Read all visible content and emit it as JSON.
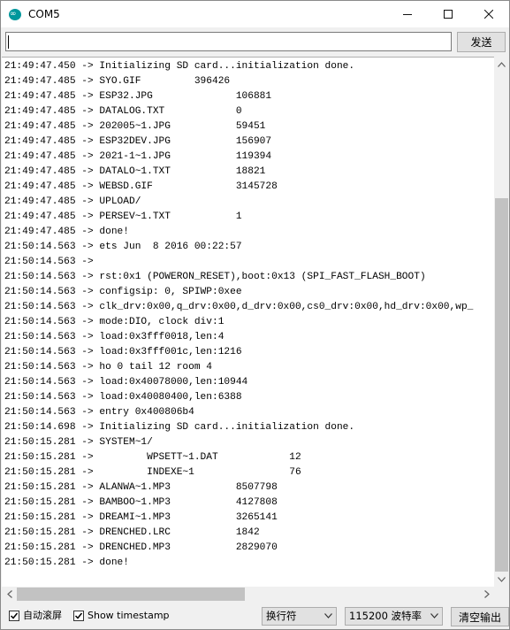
{
  "window": {
    "title": "COM5"
  },
  "input": {
    "value": "",
    "send_label": "发送"
  },
  "output_lines": [
    "21:49:47.450 -> Initializing SD card...initialization done.",
    "21:49:47.485 -> SYO.GIF         396426",
    "21:49:47.485 -> ESP32.JPG              106881",
    "21:49:47.485 -> DATALOG.TXT            0",
    "21:49:47.485 -> 202005~1.JPG           59451",
    "21:49:47.485 -> ESP32DEV.JPG           156907",
    "21:49:47.485 -> 2021-1~1.JPG           119394",
    "21:49:47.485 -> DATALO~1.TXT           18821",
    "21:49:47.485 -> WEBSD.GIF              3145728",
    "21:49:47.485 -> UPLOAD/",
    "21:49:47.485 -> PERSEV~1.TXT           1",
    "21:49:47.485 -> done!",
    "21:50:14.563 -> ets Jun  8 2016 00:22:57",
    "21:50:14.563 -> ",
    "21:50:14.563 -> rst:0x1 (POWERON_RESET),boot:0x13 (SPI_FAST_FLASH_BOOT)",
    "21:50:14.563 -> configsip: 0, SPIWP:0xee",
    "21:50:14.563 -> clk_drv:0x00,q_drv:0x00,d_drv:0x00,cs0_drv:0x00,hd_drv:0x00,wp_",
    "21:50:14.563 -> mode:DIO, clock div:1",
    "21:50:14.563 -> load:0x3fff0018,len:4",
    "21:50:14.563 -> load:0x3fff001c,len:1216",
    "21:50:14.563 -> ho 0 tail 12 room 4",
    "21:50:14.563 -> load:0x40078000,len:10944",
    "21:50:14.563 -> load:0x40080400,len:6388",
    "21:50:14.563 -> entry 0x400806b4",
    "21:50:14.698 -> Initializing SD card...initialization done.",
    "21:50:15.281 -> SYSTEM~1/",
    "21:50:15.281 ->         WPSETT~1.DAT            12",
    "21:50:15.281 ->         INDEXE~1                76",
    "21:50:15.281 -> ALANWA~1.MP3           8507798",
    "21:50:15.281 -> BAMBOO~1.MP3           4127808",
    "21:50:15.281 -> DREAMI~1.MP3           3265141",
    "21:50:15.281 -> DRENCHED.LRC           1842",
    "21:50:15.281 -> DRENCHED.MP3           2829070",
    "21:50:15.281 -> done!"
  ],
  "footer": {
    "autoscroll_label": "自动滚屏",
    "autoscroll_checked": true,
    "timestamp_label": "Show timestamp",
    "timestamp_checked": true,
    "line_ending": "换行符",
    "baud_rate": "115200 波特率",
    "clear_label": "清空输出"
  },
  "colors": {
    "app_icon": "#00979c",
    "scroll_thumb": "#c2c2c2"
  }
}
